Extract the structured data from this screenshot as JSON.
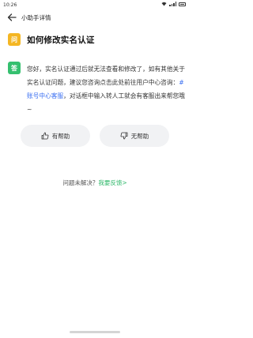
{
  "status": {
    "time": "10:26"
  },
  "header": {
    "title": "小助手详情"
  },
  "question": {
    "badge": "问",
    "text": "如何修改实名认证"
  },
  "answer": {
    "badge": "答",
    "text_before": "您好，实名认证通过后就无法查看和修改了，如有其他关于实名认证问题，建议您咨询点击此处前往用户中心咨询：",
    "link": "#账号中心客服",
    "text_after": "，对话框中输入转人工就会有客服出来帮您哦~"
  },
  "actions": {
    "helpful_label": "有帮助",
    "unhelpful_label": "无帮助"
  },
  "feedback": {
    "prompt": "问题未解决？",
    "link": "我要反馈>"
  },
  "colors": {
    "question_badge": "#f4b623",
    "answer_badge": "#35c06f",
    "link": "#3a6ff2",
    "feedback_link": "#2fb86a"
  }
}
